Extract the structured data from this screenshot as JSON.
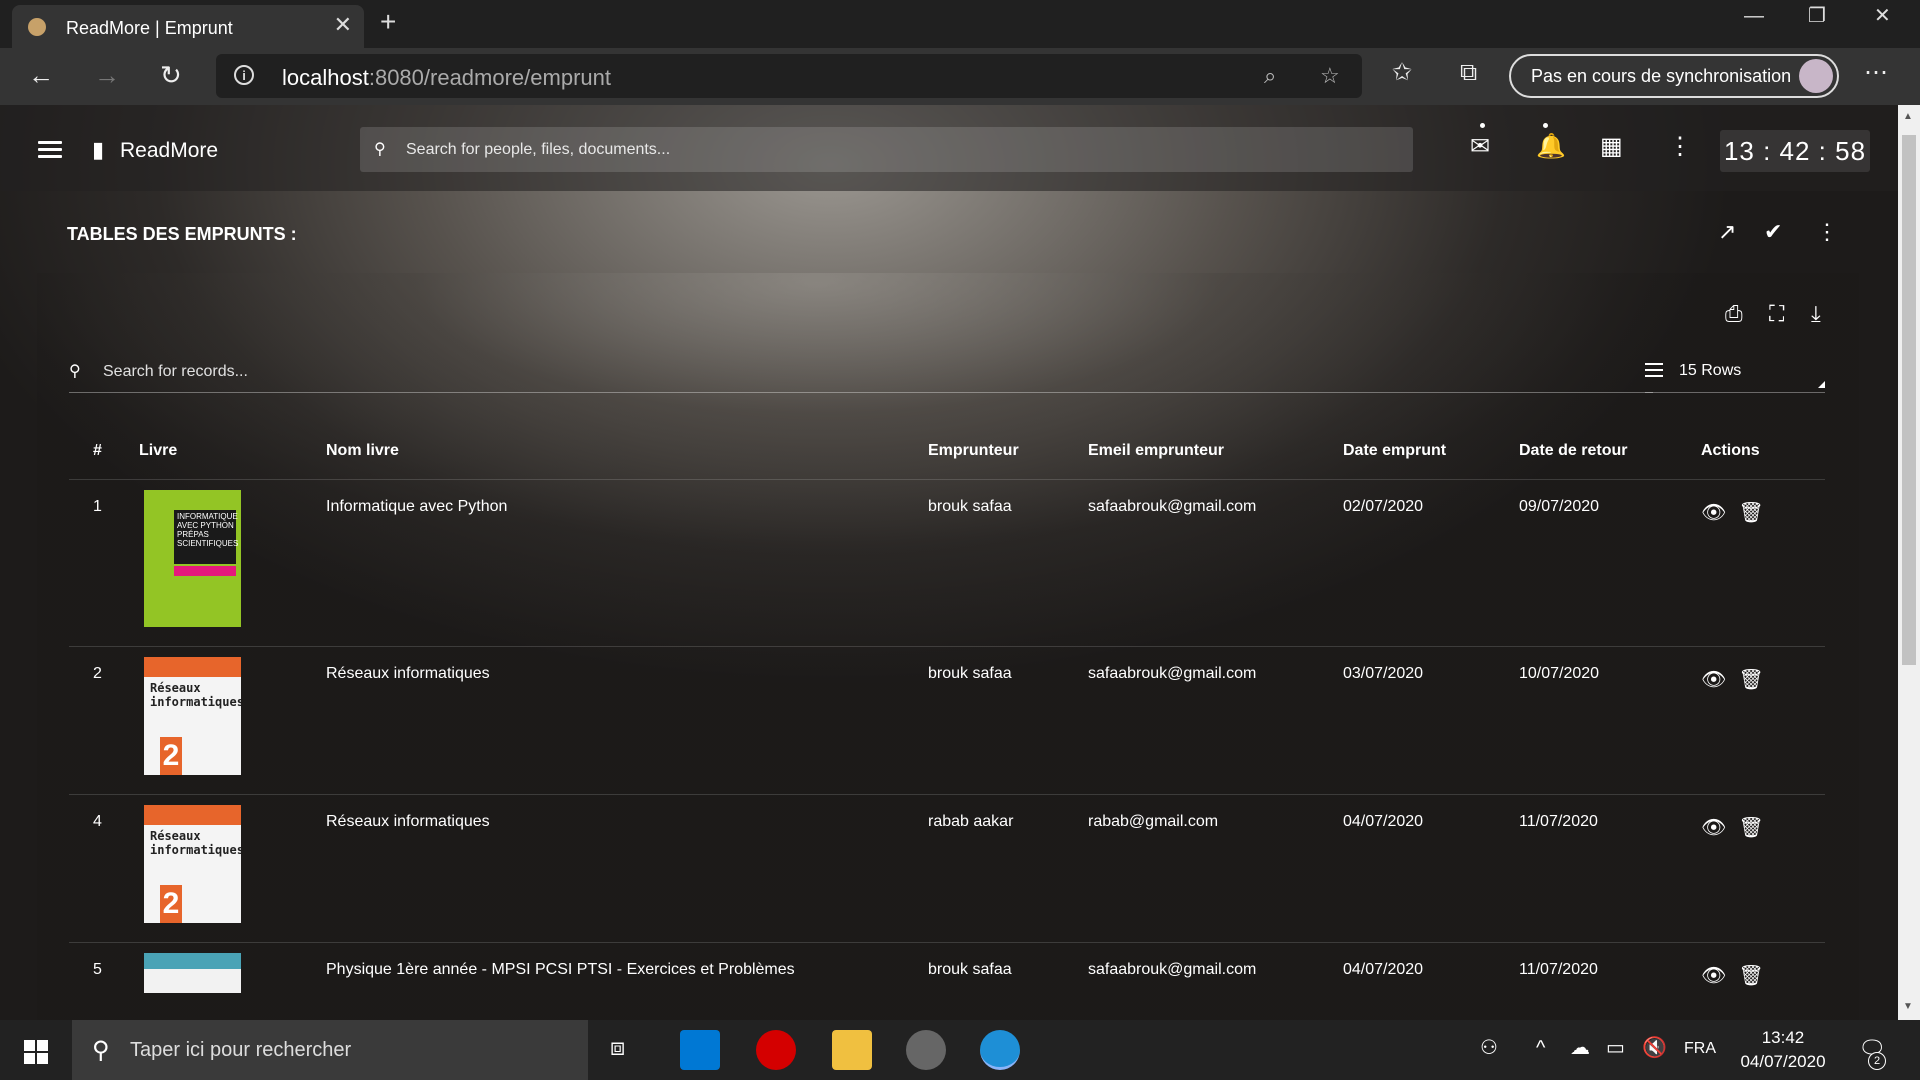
{
  "browser": {
    "tab_title": "ReadMore | Emprunt",
    "url_host": "localhost",
    "url_path": ":8080/readmore/emprunt",
    "sync_label": "Pas en cours de synchronisation"
  },
  "app": {
    "brand": "ReadMore",
    "search_placeholder": "Search for people, files, documents...",
    "clock": "13 : 42 : 58"
  },
  "section": {
    "title": "TABLES DES EMPRUNTS :"
  },
  "table_controls": {
    "search_placeholder": "Search for records...",
    "rows_label": "15 Rows"
  },
  "table": {
    "headers": [
      "#",
      "Livre",
      "Nom livre",
      "Emprunteur",
      "Emeil emprunteur",
      "Date emprunt",
      "Date de retour",
      "Actions"
    ],
    "rows": [
      {
        "num": "1",
        "cover": "python",
        "title": "Informatique avec Python",
        "borrower": "brouk safaa",
        "email": "safaabrouk@gmail.com",
        "date_borrow": "02/07/2020",
        "date_return": "09/07/2020"
      },
      {
        "num": "2",
        "cover": "reseaux",
        "title": "Réseaux informatiques",
        "borrower": "brouk safaa",
        "email": "safaabrouk@gmail.com",
        "date_borrow": "03/07/2020",
        "date_return": "10/07/2020"
      },
      {
        "num": "4",
        "cover": "reseaux",
        "title": "Réseaux informatiques",
        "borrower": "rabab aakar",
        "email": "rabab@gmail.com",
        "date_borrow": "04/07/2020",
        "date_return": "11/07/2020"
      },
      {
        "num": "5",
        "cover": "physique",
        "title": "Physique 1ère année - MPSI PCSI PTSI - Exercices et Problèmes",
        "borrower": "brouk safaa",
        "email": "safaabrouk@gmail.com",
        "date_borrow": "04/07/2020",
        "date_return": "11/07/2020"
      }
    ]
  },
  "covers": {
    "python_text": "INFORMATIQUE AVEC PYTHON PRÉPAS SCIENTIFIQUES",
    "reseaux_text": "Réseaux informatiques"
  },
  "taskbar": {
    "search_placeholder": "Taper ici pour rechercher",
    "lang": "FRA",
    "time": "13:42",
    "date": "04/07/2020",
    "notifications": "2"
  },
  "icons": {
    "menu": "hamburger-icon",
    "mail": "mail-icon",
    "bell": "bell-icon",
    "apps": "grid-icon",
    "more": "more-vert-icon",
    "trend": "trending-up-icon",
    "done_all": "done-all-icon",
    "print": "print-icon",
    "fullscreen": "fullscreen-icon",
    "download": "download-icon",
    "view": "eye-icon",
    "delete": "trash-icon"
  },
  "colors": {
    "accent_python_cover": "#93c525",
    "accent_reseaux_cover": "#e7652b",
    "accent_physique_cover": "#4aa3b6"
  }
}
